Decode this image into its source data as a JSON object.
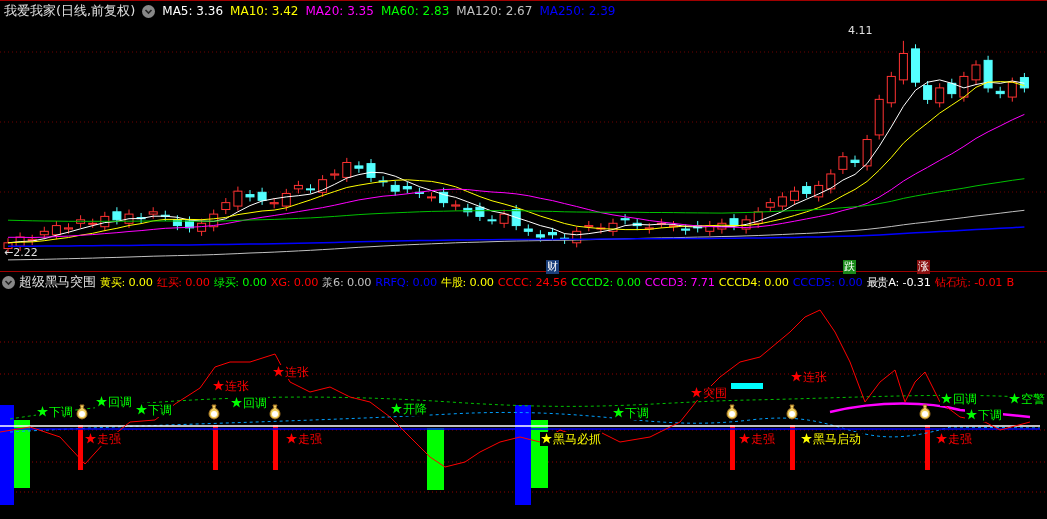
{
  "main_chart": {
    "title": "我爱我家(日线,前复权)",
    "indicators": [
      {
        "label": "MA5: 3.36",
        "color": "#ffffff"
      },
      {
        "label": "MA10: 3.42",
        "color": "#ffff00"
      },
      {
        "label": "MA20: 3.35",
        "color": "#ff00ff"
      },
      {
        "label": "MA60: 2.83",
        "color": "#00ff00"
      },
      {
        "label": "MA120: 2.67",
        "color": "#c0c0c0"
      },
      {
        "label": "MA250: 2.39",
        "color": "#0000ff"
      }
    ],
    "high_label": "4.11",
    "low_label": "←2.22",
    "events": [
      {
        "text": "财",
        "color": "#1a3f7a"
      },
      {
        "text": "跌",
        "color": "#1a8a1a"
      },
      {
        "text": "涨",
        "color": "#8a1010"
      }
    ]
  },
  "sub_chart": {
    "title": "超级黑马突围",
    "indicators": [
      {
        "label": "黄买: 0.00",
        "color": "#ffff00"
      },
      {
        "label": "红买: 0.00",
        "color": "#ff0000"
      },
      {
        "label": "绿买: 0.00",
        "color": "#00ff00"
      },
      {
        "label": "XG: 0.00",
        "color": "#ff0000"
      },
      {
        "label": "羕6: 0.00",
        "color": "#c0c0c0"
      },
      {
        "label": "RRFQ: 0.00",
        "color": "#0000ff"
      },
      {
        "label": "牛股: 0.00",
        "color": "#ffff00"
      },
      {
        "label": "CCCC: 24.56",
        "color": "#ff0000"
      },
      {
        "label": "CCCD2: 0.00",
        "color": "#00ff00"
      },
      {
        "label": "CCCD3: 7.71",
        "color": "#ff00ff"
      },
      {
        "label": "CCCD4: 0.00",
        "color": "#ffff00"
      },
      {
        "label": "CCCD5: 0.00",
        "color": "#0000ff"
      },
      {
        "label": "最贵A: -0.31",
        "color": "#ffffff"
      },
      {
        "label": "钻石坑: -0.01",
        "color": "#ff0000"
      },
      {
        "label": "B",
        "color": "#ff0000"
      }
    ],
    "signals": [
      {
        "text": "下调",
        "color": "#00ff00"
      },
      {
        "text": "回调",
        "color": "#00ff00"
      },
      {
        "text": "走强",
        "color": "#ff0000"
      },
      {
        "text": "下调",
        "color": "#00ff00"
      },
      {
        "text": "连张",
        "color": "#ff0000"
      },
      {
        "text": "回调",
        "color": "#00ff00"
      },
      {
        "text": "连张",
        "color": "#ff0000"
      },
      {
        "text": "走强",
        "color": "#ff0000"
      },
      {
        "text": "开降",
        "color": "#00ff00"
      },
      {
        "text": "黑马必抓",
        "color": "#ffff00"
      },
      {
        "text": "下调",
        "color": "#00ff00"
      },
      {
        "text": "突围",
        "color": "#ff0000"
      },
      {
        "text": "走强",
        "color": "#ff0000"
      },
      {
        "text": "连张",
        "color": "#ff0000"
      },
      {
        "text": "黑马启动",
        "color": "#ffff00"
      },
      {
        "text": "回调",
        "color": "#00ff00"
      },
      {
        "text": "走强",
        "color": "#ff0000"
      },
      {
        "text": "下调",
        "color": "#00ff00"
      },
      {
        "text": "空警",
        "color": "#00ff00"
      }
    ]
  }
}
